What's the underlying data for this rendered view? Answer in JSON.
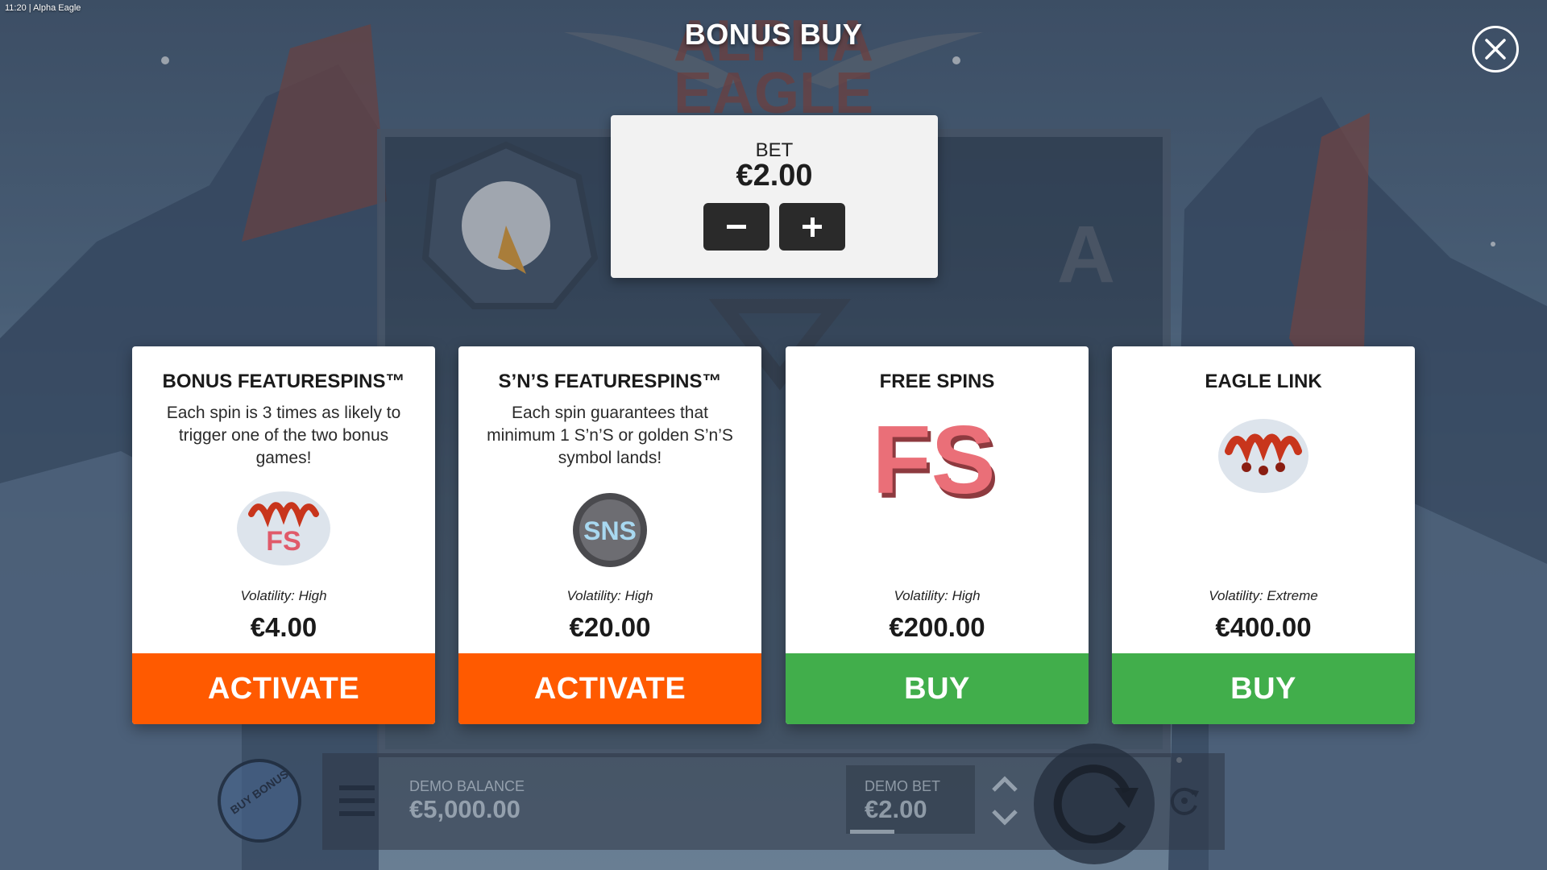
{
  "status_bar": {
    "time": "11:20",
    "separator": "|",
    "app_name": "Alpha Eagle"
  },
  "dialog": {
    "title": "BONUS BUY",
    "bet": {
      "label": "BET",
      "value": "€2.00",
      "decrease_icon": "minus-icon",
      "increase_icon": "plus-icon"
    },
    "close_icon": "close-icon",
    "options": [
      {
        "title": "BONUS FEATURESPINS™",
        "description": "Each spin is 3 times as likely to trigger one of the two bonus games!",
        "volatility": "Volatility: High",
        "price": "€4.00",
        "button": "ACTIVATE",
        "button_color": "#ff5a00"
      },
      {
        "title": "S’N’S FEATURESPINS™",
        "description": "Each spin guarantees that minimum 1 S’n’S or golden S’n’S symbol lands!",
        "volatility": "Volatility: High",
        "price": "€20.00",
        "button": "ACTIVATE",
        "button_color": "#ff5a00",
        "art_text": "SNS"
      },
      {
        "title": "FREE SPINS",
        "description": "",
        "volatility": "Volatility: High",
        "price": "€200.00",
        "button": "BUY",
        "button_color": "#41ae4b",
        "art_text": "FS"
      },
      {
        "title": "EAGLE LINK",
        "description": "",
        "volatility": "Volatility: Extreme",
        "price": "€400.00",
        "button": "BUY",
        "button_color": "#41ae4b"
      }
    ]
  },
  "bottom_bar": {
    "buy_bonus": "BUY BONUS",
    "demo_balance_label": "DEMO BALANCE",
    "demo_balance_value": "€5,000.00",
    "demo_bet_label": "DEMO BET",
    "demo_bet_value": "€2.00",
    "menu_icon": "hamburger-menu-icon",
    "spin_icon": "spin-arrow-icon",
    "autoplay_icon": "autoplay-icon"
  }
}
